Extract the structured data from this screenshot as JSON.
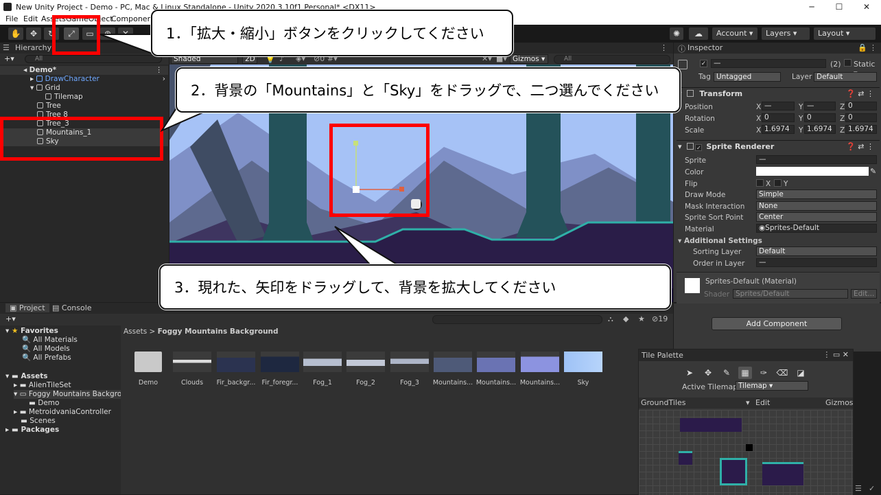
{
  "window": {
    "title": "New Unity Project - Demo - PC, Mac & Linux Standalone - Unity 2020.3.10f1 Personal* <DX11>",
    "min": "─",
    "max": "☐",
    "close": "✕"
  },
  "menu": [
    "File",
    "Edit",
    "Assets",
    "GameObject",
    "Component"
  ],
  "toolbar": {
    "account": "Account",
    "layers": "Layers",
    "layout": "Layout"
  },
  "hierarchy": {
    "tab": "Hierarchy",
    "search": "All",
    "scene": "Demo*",
    "items": [
      "DrawCharacter",
      "Grid",
      "Tilemap",
      "Tree",
      "Tree 8",
      "Tree_3",
      "Mountains_1",
      "Sky"
    ]
  },
  "scene_view": {
    "shading": "Shaded",
    "mode2d": "2D",
    "gizmos": "Gizmos",
    "search": "All",
    "gizmo_count": "0"
  },
  "inspector": {
    "tab": "Inspector",
    "name_value": "—",
    "count": "(2)",
    "static": "Static",
    "tag_label": "Tag",
    "tag_value": "Untagged",
    "layer_label": "Layer",
    "layer_value": "Default",
    "transform": {
      "title": "Transform",
      "position": {
        "label": "Position",
        "x": "—",
        "y": "—",
        "z": "0"
      },
      "rotation": {
        "label": "Rotation",
        "x": "0",
        "y": "0",
        "z": "0"
      },
      "scale": {
        "label": "Scale",
        "x": "1.6974",
        "y": "1.6974",
        "z": "1.6974"
      }
    },
    "sprite_renderer": {
      "title": "Sprite Renderer",
      "sprite": {
        "label": "Sprite",
        "value": "—"
      },
      "color": {
        "label": "Color"
      },
      "flip": {
        "label": "Flip",
        "x": "X",
        "y": "Y"
      },
      "draw_mode": {
        "label": "Draw Mode",
        "value": "Simple"
      },
      "mask": {
        "label": "Mask Interaction",
        "value": "None"
      },
      "sort_point": {
        "label": "Sprite Sort Point",
        "value": "Center"
      },
      "material": {
        "label": "Material",
        "value": "Sprites-Default"
      },
      "additional": "Additional Settings",
      "sorting_layer": {
        "label": "Sorting Layer",
        "value": "Default"
      },
      "order": {
        "label": "Order in Layer",
        "value": "—"
      }
    },
    "material_box": {
      "title": "Sprites-Default (Material)",
      "shader_label": "Shader",
      "shader_value": "Sprites/Default",
      "edit": "Edit..."
    },
    "add_component": "Add Component"
  },
  "project": {
    "tabs": [
      "Project",
      "Console"
    ],
    "breadcrumb_root": "Assets",
    "breadcrumb_sep": ">",
    "breadcrumb_leaf": "Foggy Mountains Background",
    "hidden_count": "19",
    "favorites": "Favorites",
    "fav_items": [
      "All Materials",
      "All Models",
      "All Prefabs"
    ],
    "assets_root": "Assets",
    "folders": [
      "AlienTileSet",
      "Foggy Mountains Backgrou",
      "Demo",
      "MetroidvaniaController",
      "Scenes"
    ],
    "packages": "Packages",
    "files": [
      "Demo",
      "Clouds",
      "Fir_backgr...",
      "Fir_foregr...",
      "Fog_1",
      "Fog_2",
      "Fog_3",
      "Mountains...",
      "Mountains...",
      "Mountains...",
      "Sky"
    ]
  },
  "tile_palette": {
    "title": "Tile Palette",
    "active_label": "Active Tilemap",
    "active_value": "Tilemap",
    "palette": "GroundTiles",
    "edit": "Edit",
    "gizmos": "Gizmos"
  },
  "callouts": {
    "step1": "1．「拡大・縮小」ボタンをクリックしてください",
    "step2": "2．背景の「Mountains」と「Sky」をドラッグで、二つ選んでください",
    "step3": "3．現れた、矢印をドラッグして、背景を拡大してください"
  },
  "colors": {
    "highlight": "#ff0000",
    "selection_blue": "#4a90e2",
    "sky": "#a9c6fb",
    "ground": "#2a1f4a"
  }
}
